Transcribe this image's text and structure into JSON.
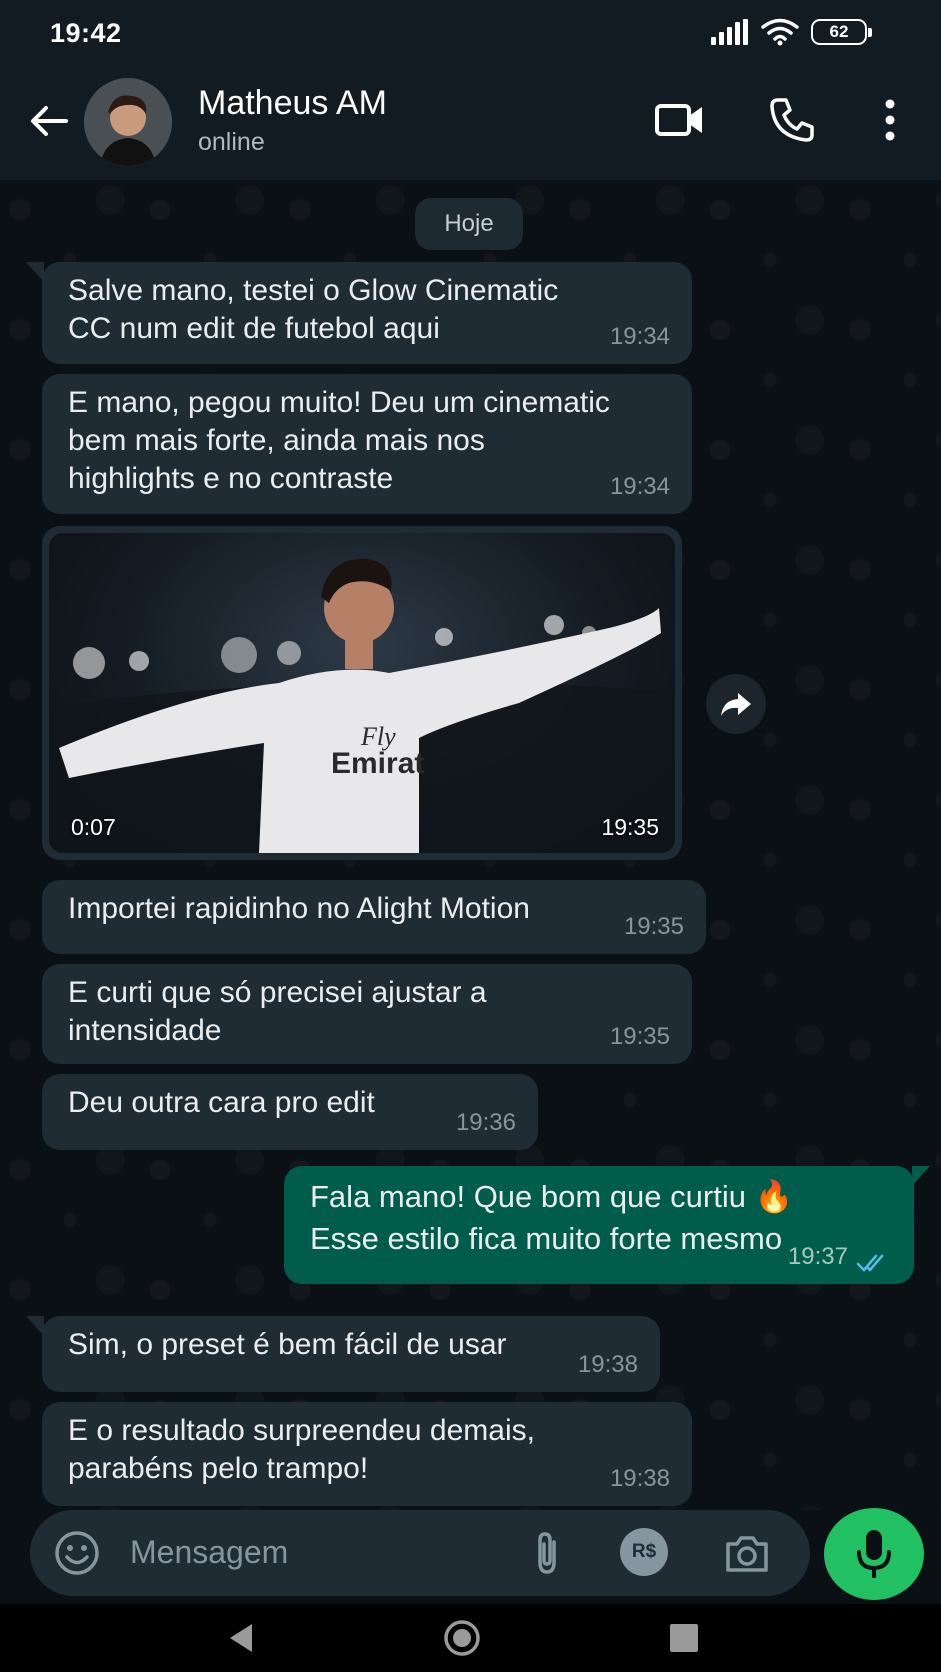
{
  "status_bar": {
    "time": "19:42",
    "battery": "62"
  },
  "header": {
    "contact_name": "Matheus AM",
    "contact_status": "online"
  },
  "date_chip": "Hoje",
  "messages": [
    {
      "text": "Salve mano, testei o Glow Cinematic\nCC num edit de futebol aqui",
      "time": "19:34"
    },
    {
      "text": "E mano, pegou muito! Deu um cinematic\nbem mais forte, ainda mais nos\nhighlights e no contraste",
      "time": "19:34"
    },
    {
      "duration": "0:07",
      "time": "19:35"
    },
    {
      "text": "Importei rapidinho no Alight Motion",
      "time": "19:35"
    },
    {
      "text": "E curti que só precisei ajustar a\nintensidade",
      "time": "19:35"
    },
    {
      "text": "Deu outra cara pro edit",
      "time": "19:36"
    },
    {
      "text": "Fala mano! Que bom que curtiu 🔥\nEsse estilo fica muito forte mesmo",
      "time": "19:37"
    },
    {
      "text": "Sim, o preset é bem fácil de usar",
      "time": "19:38"
    },
    {
      "text": "E o resultado surpreendeu demais,\nparabéns pelo trampo!",
      "time": "19:38"
    }
  ],
  "input": {
    "placeholder": "Mensagem"
  },
  "colors": {
    "incoming_bubble": "#202c33",
    "outgoing_bubble": "#005c4b",
    "mic_button": "#21c063",
    "read_ticks": "#53bdeb"
  }
}
